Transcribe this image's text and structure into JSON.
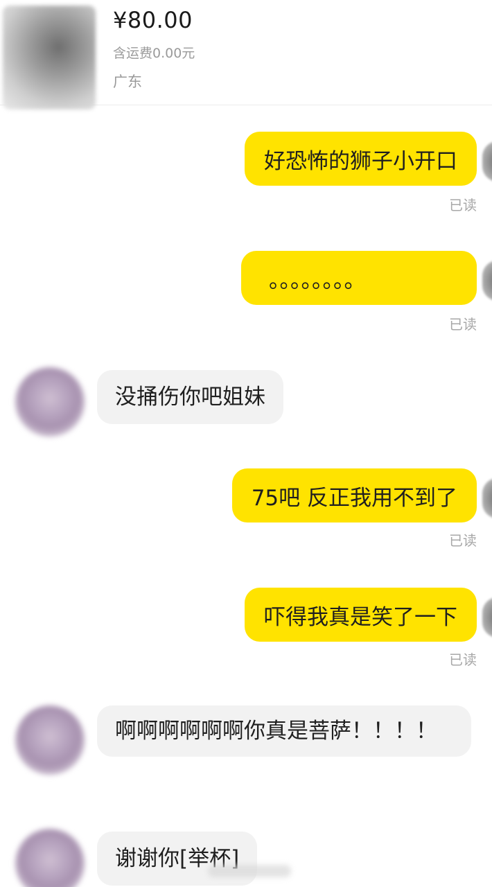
{
  "product": {
    "price": "¥80.00",
    "shipping": "含运费0.00元",
    "location": "广东"
  },
  "read_label": "已读",
  "messages": [
    {
      "side": "right",
      "text": "好恐怖的狮子小开口",
      "status": "已读"
    },
    {
      "side": "right",
      "text": "。。。。。。。。",
      "status": "已读"
    },
    {
      "side": "left",
      "text": "没捅伤你吧姐妹"
    },
    {
      "side": "right",
      "text": "75吧 反正我用不到了",
      "status": "已读"
    },
    {
      "side": "right",
      "text": "吓得我真是笑了一下",
      "status": "已读"
    },
    {
      "side": "left",
      "text": "啊啊啊啊啊啊你真是菩萨！！！！"
    },
    {
      "side": "left",
      "text": "谢谢你[举杯]"
    }
  ]
}
